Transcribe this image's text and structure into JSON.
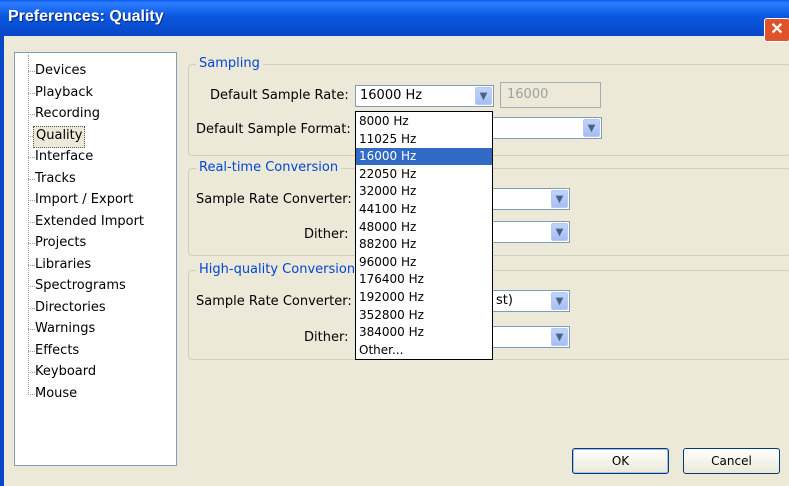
{
  "window": {
    "title": "Preferences: Quality",
    "close_glyph": "✕"
  },
  "tree": {
    "items": [
      "Devices",
      "Playback",
      "Recording",
      "Quality",
      "Interface",
      "Tracks",
      "Import / Export",
      "Extended Import",
      "Projects",
      "Libraries",
      "Spectrograms",
      "Directories",
      "Warnings",
      "Effects",
      "Keyboard",
      "Mouse"
    ],
    "selected": "Quality"
  },
  "sampling": {
    "title": "Sampling",
    "rate_label": "Default Sample Rate:",
    "rate_value": "16000 Hz",
    "rate_text": "16000",
    "format_label": "Default Sample Format:"
  },
  "realtime": {
    "title": "Real-time Conversion",
    "converter_label": "Sample Rate Converter:",
    "dither_label": "Dither:"
  },
  "highquality": {
    "title": "High-quality Conversion",
    "converter_label": "Sample Rate Converter:",
    "converter_value_partial": "st)",
    "dither_label": "Dither:"
  },
  "dropdown": {
    "options": [
      "8000 Hz",
      "11025 Hz",
      "16000 Hz",
      "22050 Hz",
      "32000 Hz",
      "44100 Hz",
      "48000 Hz",
      "88200 Hz",
      "96000 Hz",
      "176400 Hz",
      "192000 Hz",
      "352800 Hz",
      "384000 Hz",
      "Other..."
    ],
    "selected": "16000 Hz"
  },
  "buttons": {
    "ok": "OK",
    "cancel": "Cancel"
  },
  "icons": {
    "dropdown_arrow": "chevron-down-icon"
  },
  "colors": {
    "title_bar": "#0a58e0",
    "selection": "#316ac5",
    "group_title": "#0046d5",
    "close": "#e0532a"
  }
}
